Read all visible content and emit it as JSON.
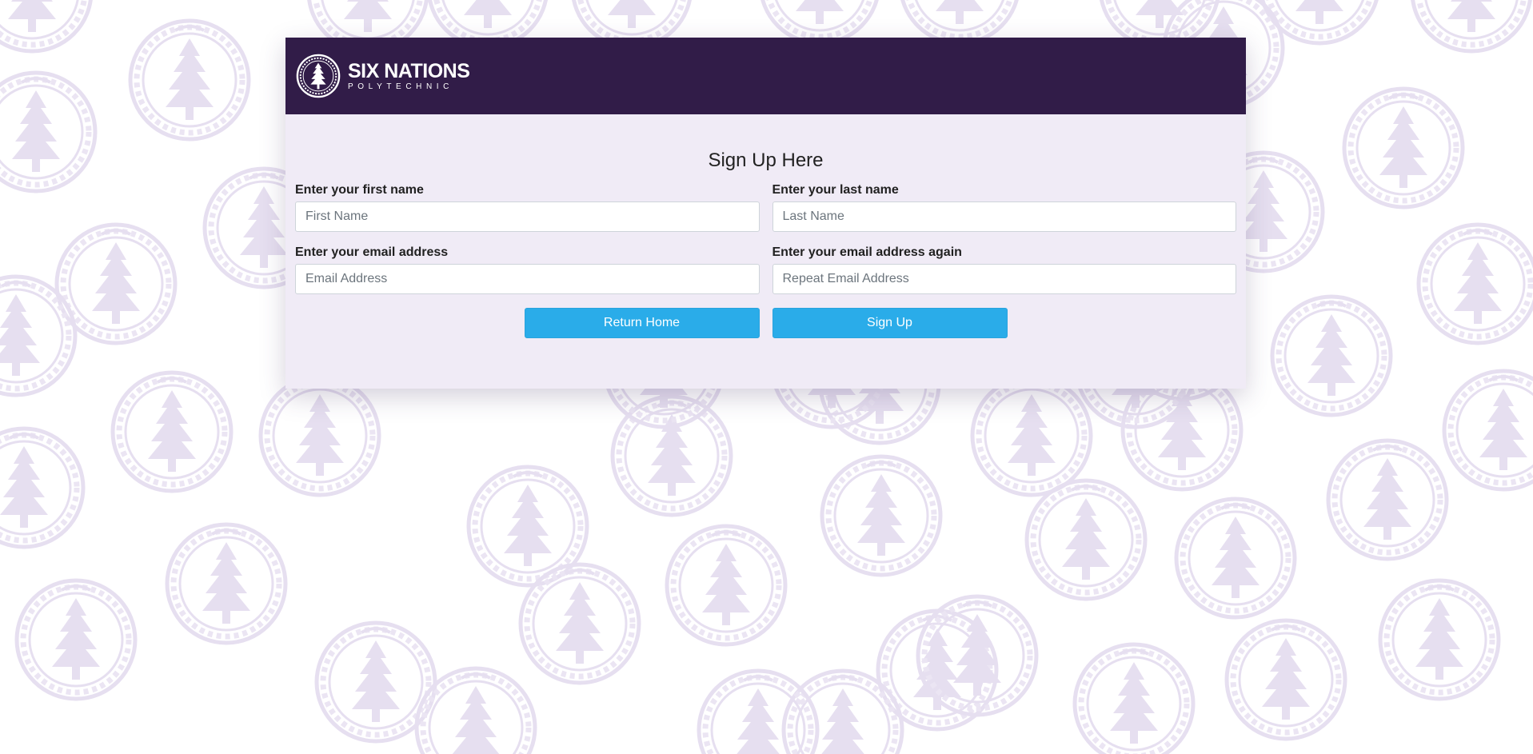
{
  "brand": {
    "name": "SIX NATIONS",
    "subtitle": "POLYTECHNIC",
    "header_color": "#311c48",
    "logo_icon": "tree-seal-icon"
  },
  "background": {
    "pattern_icon": "tree-seal-icon",
    "pattern_color": "#e9e3f1"
  },
  "form": {
    "title": "Sign Up Here",
    "fields": {
      "first_name": {
        "label": "Enter your first name",
        "placeholder": "First Name",
        "value": ""
      },
      "last_name": {
        "label": "Enter your last name",
        "placeholder": "Last Name",
        "value": ""
      },
      "email": {
        "label": "Enter your email address",
        "placeholder": "Email Address",
        "value": ""
      },
      "email_repeat": {
        "label": "Enter your email address again",
        "placeholder": "Repeat Email Address",
        "value": ""
      }
    },
    "buttons": {
      "return_home": "Return Home",
      "sign_up": "Sign Up"
    },
    "button_color": "#2aace9"
  }
}
